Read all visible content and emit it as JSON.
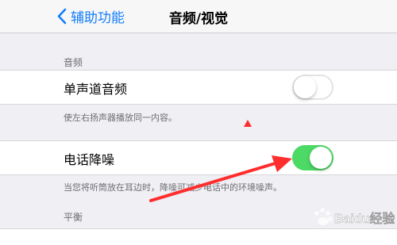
{
  "navbar": {
    "back_label": "辅助功能",
    "title": "音频/视觉"
  },
  "audio_section": {
    "header": "音频",
    "mono_audio": {
      "label": "单声道音频",
      "on": false
    },
    "mono_audio_footer": "使左右扬声器播放同一内容。"
  },
  "phone_noise": {
    "label": "电话降噪",
    "on": true,
    "footer": "当您将听筒放在耳边时，降噪可减少电话中的环境噪声。"
  },
  "balance_section": {
    "header": "平衡"
  },
  "watermark": {
    "text": "Baidu经验"
  },
  "colors": {
    "accent": "#147efb",
    "switch_on": "#4cd964",
    "annotation": "#ff2d2d"
  }
}
